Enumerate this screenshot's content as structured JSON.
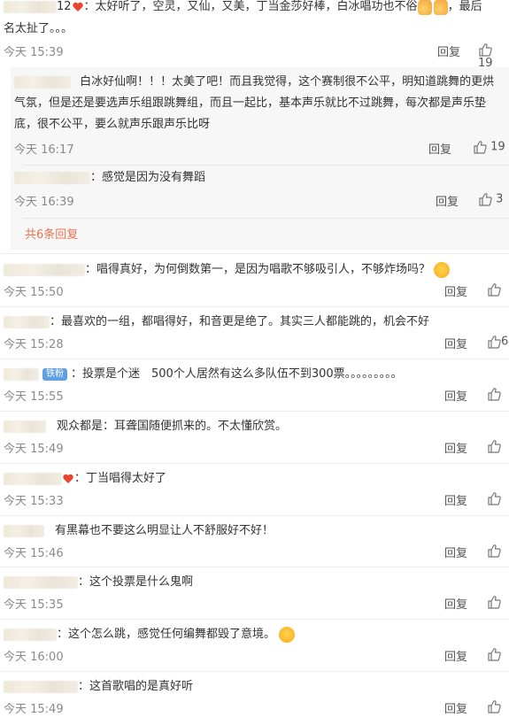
{
  "comments": [
    {
      "user_suffix": "12",
      "text_line1": "：太好听了，空灵，又仙，又美，丁当金莎好棒，白冰唱功也不俗",
      "text_tail": "，最后",
      "text_line2": "名太扯了。。。",
      "time": "今天 15:39",
      "reply": "回复",
      "likes": "19"
    }
  ],
  "sub_comments": [
    {
      "text_line1": "白冰好仙啊！！！太美了吧！而且我觉得，这个赛制很不公平，明知道跳舞的更烘",
      "text_line2": "气氛，但是还是要选声乐组跟跳舞组，而且一起比，基本声乐就比不过跳舞，每次都是声乐垫",
      "text_line3": "底，很不公平，要么就声乐跟声乐比呀",
      "time": "今天 16:17",
      "reply": "回复",
      "likes": "19"
    },
    {
      "text_line1": "：感觉是因为没有舞蹈",
      "time": "今天 16:39",
      "reply": "回复",
      "likes": "3"
    }
  ],
  "more_replies": "共6条回复",
  "list": [
    {
      "text": "：唱得真好，为何倒数第一，是因为唱歌不够吸引人，不够炸场吗？",
      "time": "今天 15:50",
      "reply": "回复",
      "likes": ""
    },
    {
      "text": "：最喜欢的一组，都唱得好，和音更是绝了。其实三人都能跳的，机会不好",
      "time": "今天 15:28",
      "reply": "回复",
      "likes": "6"
    },
    {
      "badge": "铁粉",
      "text": "：投票是个迷　500个人居然有这么多队伍不到300票。。。。。。。。。",
      "time": "今天 15:55",
      "reply": "回复",
      "likes": ""
    },
    {
      "text": "观众都是：耳聋国随便抓来的。不太懂欣赏。",
      "time": "今天 15:49",
      "reply": "回复",
      "likes": ""
    },
    {
      "text": "：丁当唱得太好了",
      "time": "今天 15:33",
      "reply": "回复",
      "likes": ""
    },
    {
      "text": "有黑幕也不要这么明显让人不舒服好不好！",
      "time": "今天 15:46",
      "reply": "回复",
      "likes": ""
    },
    {
      "text": "：这个投票是什么鬼啊",
      "time": "今天 15:35",
      "reply": "回复",
      "likes": ""
    },
    {
      "text": "：这个怎么跳，感觉任何编舞都毁了意境。",
      "time": "今天 16:00",
      "reply": "回复",
      "likes": ""
    },
    {
      "text": "：这首歌唱的是真好听",
      "time": "今天 15:49",
      "reply": "回复",
      "likes": ""
    }
  ],
  "icons": {
    "like": "thumbs-up-icon"
  },
  "colors": {
    "link": "#eb7350",
    "meta": "#8a8a8a",
    "badge": "#5fa0e3"
  }
}
